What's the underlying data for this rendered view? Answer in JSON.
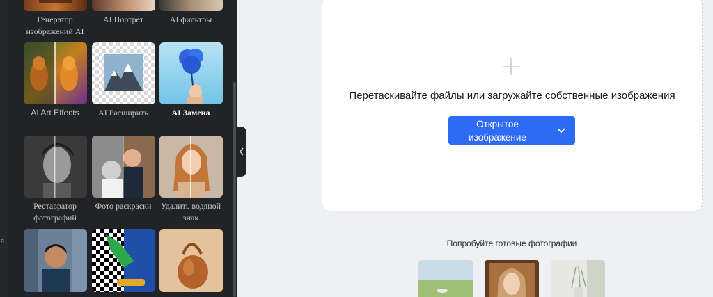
{
  "rail": {
    "partial_text": "я"
  },
  "tools": [
    {
      "line1": "Генератор",
      "line2": "изображений AI"
    },
    {
      "line1": "AI Портрет"
    },
    {
      "line1": "AI фильтры"
    },
    {
      "line1": "AI Art Effects"
    },
    {
      "line1": "AI Расширить"
    },
    {
      "line1": "AI Замена"
    },
    {
      "line1": "Реставратор",
      "line2": "фотографий"
    },
    {
      "line1": "Фото раскраски"
    },
    {
      "line1": "Удалить водяной",
      "line2": "знак"
    }
  ],
  "upload": {
    "drop_text": "Перетаскивайте файлы или загружайте собственные изображения",
    "open_button_line1": "Открытое",
    "open_button_line2": "изображение"
  },
  "samples": {
    "heading": "Попробуйте готовые фотографии"
  },
  "colors": {
    "panel_bg": "#222326",
    "page_bg": "#eef0f3",
    "accent": "#2f6cf6"
  },
  "icons": [
    "plus-icon",
    "chevron-down-icon",
    "chevron-left-icon"
  ]
}
